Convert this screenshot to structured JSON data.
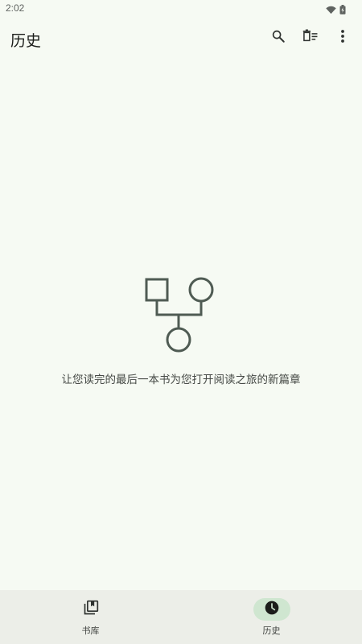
{
  "status_bar": {
    "time": "2:02",
    "icons": [
      "wifi-icon",
      "battery-icon"
    ]
  },
  "app_bar": {
    "title": "历史",
    "actions": [
      "search-icon",
      "delete-history-icon",
      "more-vert-icon"
    ]
  },
  "empty_state": {
    "icon": "family-tree-icon",
    "message": "让您读完的最后一本书为您打开阅读之旅的新篇章"
  },
  "bottom_nav": {
    "items": [
      {
        "label": "书库",
        "icon": "library-icon",
        "selected": false
      },
      {
        "label": "历史",
        "icon": "history-clock-icon",
        "selected": true
      }
    ]
  },
  "colors": {
    "background": "#f6faf3",
    "nav_background": "#eceee8",
    "active_indicator": "#cfe6d0",
    "illustration": "#4f5b53"
  }
}
